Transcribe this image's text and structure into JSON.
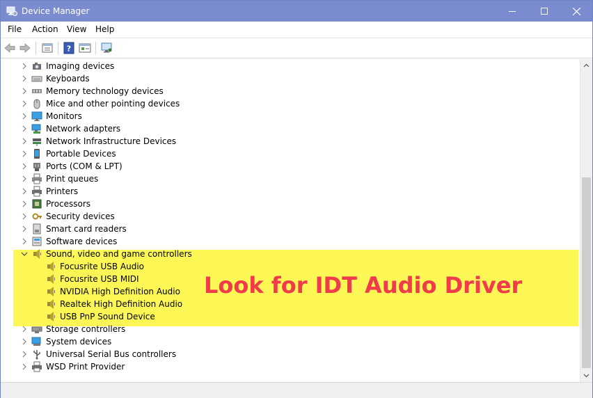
{
  "window": {
    "title": "Device Manager"
  },
  "menu": [
    "File",
    "Action",
    "View",
    "Help"
  ],
  "callout": "Look for IDT Audio Driver",
  "colors": {
    "titlebar": "#7a8ccf",
    "highlight": "#fdf755",
    "callout": "#ef3b4a"
  },
  "tree": [
    {
      "label": "Imaging devices",
      "icon": "camera-icon",
      "expanded": false,
      "level": 0
    },
    {
      "label": "Keyboards",
      "icon": "keyboard-icon",
      "expanded": false,
      "level": 0
    },
    {
      "label": "Memory technology devices",
      "icon": "memory-icon",
      "expanded": false,
      "level": 0
    },
    {
      "label": "Mice and other pointing devices",
      "icon": "mouse-icon",
      "expanded": false,
      "level": 0
    },
    {
      "label": "Monitors",
      "icon": "monitor-icon",
      "expanded": false,
      "level": 0
    },
    {
      "label": "Network adapters",
      "icon": "network-adapter-icon",
      "expanded": false,
      "level": 0
    },
    {
      "label": "Network Infrastructure Devices",
      "icon": "network-infrastructure-icon",
      "expanded": false,
      "level": 0
    },
    {
      "label": "Portable Devices",
      "icon": "portable-device-icon",
      "expanded": false,
      "level": 0
    },
    {
      "label": "Ports (COM & LPT)",
      "icon": "port-icon",
      "expanded": false,
      "level": 0
    },
    {
      "label": "Print queues",
      "icon": "print-queue-icon",
      "expanded": false,
      "level": 0
    },
    {
      "label": "Printers",
      "icon": "printer-icon",
      "expanded": false,
      "level": 0
    },
    {
      "label": "Processors",
      "icon": "processor-icon",
      "expanded": false,
      "level": 0
    },
    {
      "label": "Security devices",
      "icon": "security-key-icon",
      "expanded": false,
      "level": 0
    },
    {
      "label": "Smart card readers",
      "icon": "smart-card-icon",
      "expanded": false,
      "level": 0
    },
    {
      "label": "Software devices",
      "icon": "software-device-icon",
      "expanded": false,
      "level": 0
    },
    {
      "label": "Sound, video and game controllers",
      "icon": "speaker-icon",
      "expanded": true,
      "level": 0
    },
    {
      "label": "Focusrite USB Audio",
      "icon": "speaker-icon",
      "level": 1
    },
    {
      "label": "Focusrite USB MIDI",
      "icon": "speaker-icon",
      "level": 1
    },
    {
      "label": "NVIDIA High Definition Audio",
      "icon": "speaker-icon",
      "level": 1
    },
    {
      "label": "Realtek High Definition Audio",
      "icon": "speaker-icon",
      "level": 1
    },
    {
      "label": "USB PnP Sound Device",
      "icon": "speaker-icon",
      "level": 1
    },
    {
      "label": "Storage controllers",
      "icon": "storage-icon",
      "expanded": false,
      "level": 0
    },
    {
      "label": "System devices",
      "icon": "system-device-icon",
      "expanded": false,
      "level": 0
    },
    {
      "label": "Universal Serial Bus controllers",
      "icon": "usb-icon",
      "expanded": false,
      "level": 0
    },
    {
      "label": "WSD Print Provider",
      "icon": "wsd-printer-icon",
      "expanded": false,
      "level": 0
    }
  ]
}
